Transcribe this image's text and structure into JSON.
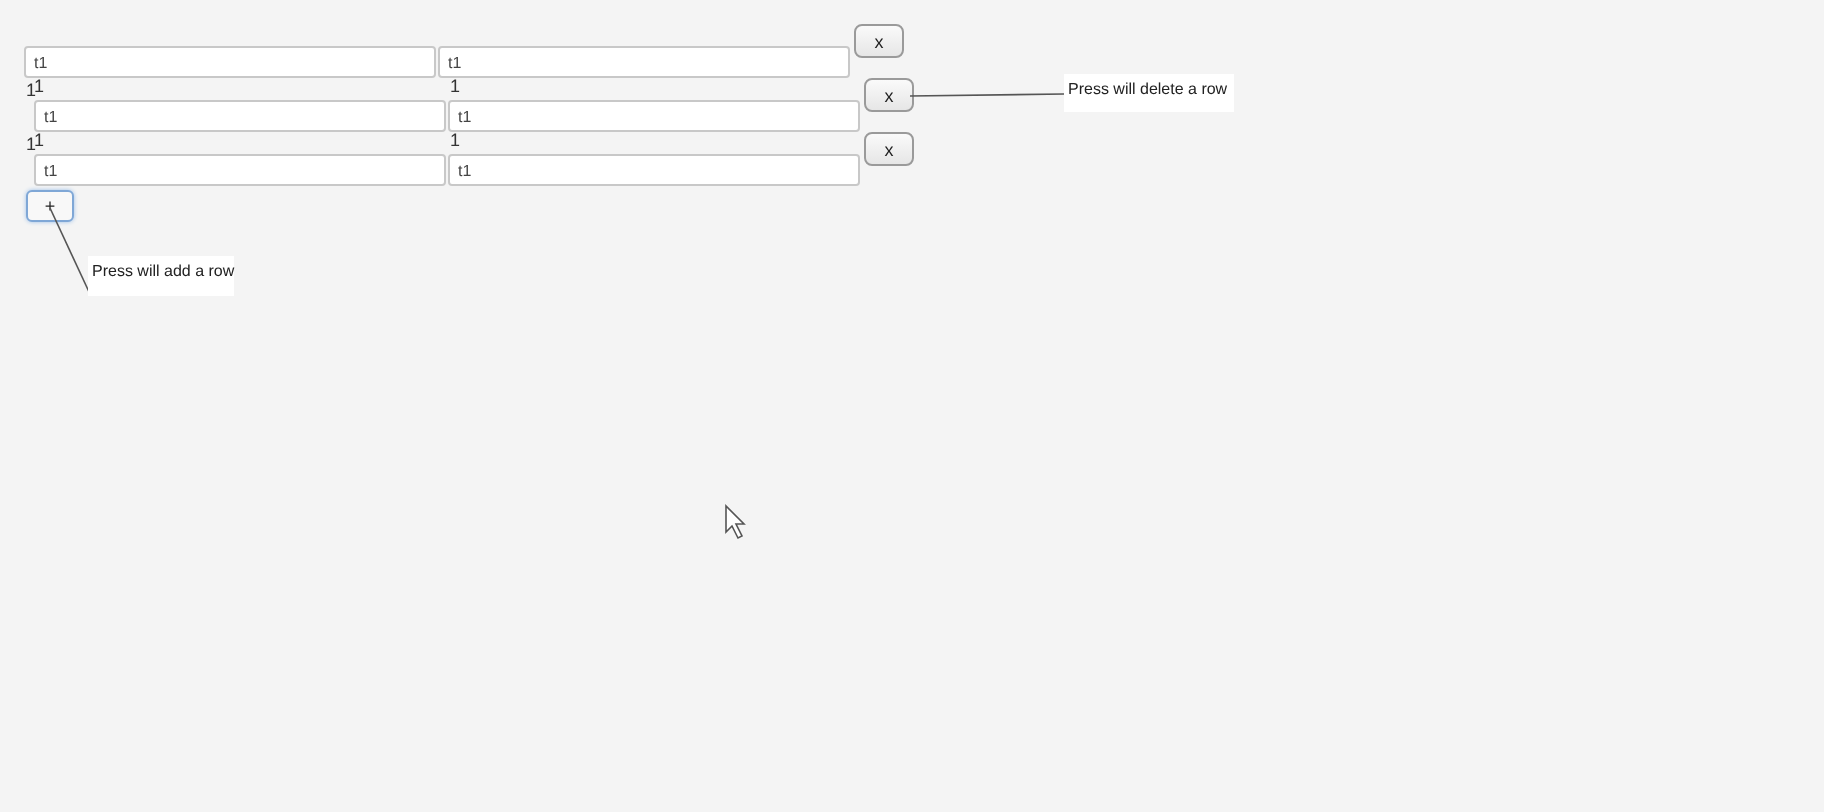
{
  "rows": [
    {
      "indented": false,
      "left_labels": [],
      "right_label": "",
      "fields": [
        "t1",
        "t1"
      ],
      "delete_button": "x"
    },
    {
      "indented": true,
      "left_labels": [
        "1",
        "1"
      ],
      "right_label": "1",
      "fields": [
        "t1",
        "t1"
      ],
      "delete_button": "x"
    },
    {
      "indented": true,
      "left_labels": [
        "1",
        "1"
      ],
      "right_label": "1",
      "fields": [
        "t1",
        "t1"
      ],
      "delete_button": "x"
    }
  ],
  "add_button": "+",
  "callouts": [
    {
      "kind": "delete",
      "text": "Press will delete a row"
    },
    {
      "kind": "add",
      "text": "Press will add a row"
    }
  ]
}
